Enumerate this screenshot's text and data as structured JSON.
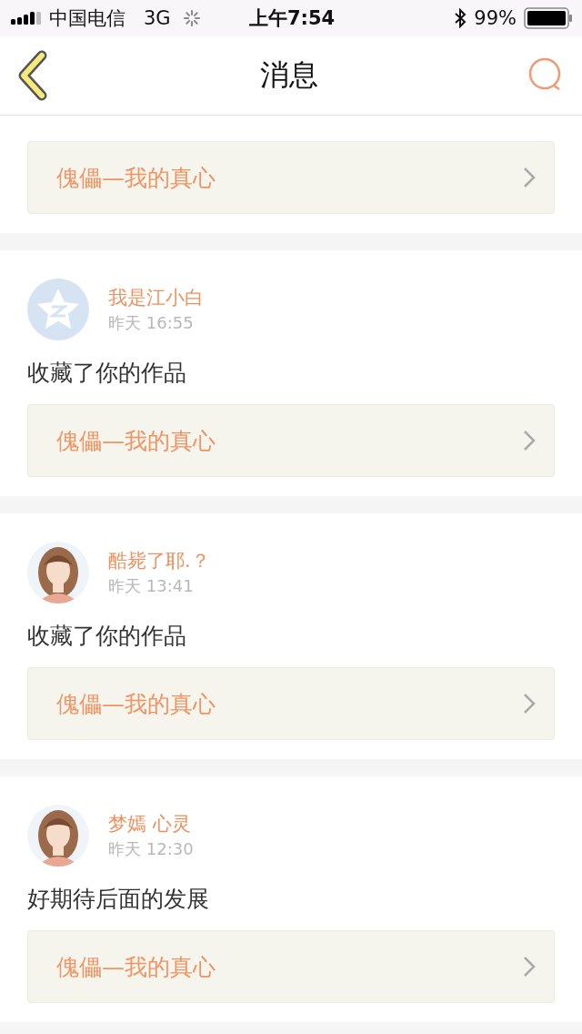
{
  "status_bar": {
    "carrier": "中国电信",
    "network": "3G",
    "time": "上午7:54",
    "battery": "99%"
  },
  "header": {
    "title": "消息"
  },
  "messages": [
    {
      "kind": "partial",
      "work": "傀儡—我的真心"
    },
    {
      "kind": "full",
      "avatar": {
        "kind": "default"
      },
      "user": "我是江小白",
      "time": "昨天 16:55",
      "comment": "收藏了你的作品",
      "work": "傀儡—我的真心"
    },
    {
      "kind": "full",
      "user": "酷毙了耶.？",
      "time": "昨天 13:41",
      "comment": "收藏了你的作品",
      "work": "傀儡—我的真心"
    },
    {
      "kind": "full",
      "user": "梦嫣 心灵",
      "time": "昨天 12:30",
      "comment": "好期待后面的发展",
      "work": "傀儡—我的真心"
    }
  ]
}
